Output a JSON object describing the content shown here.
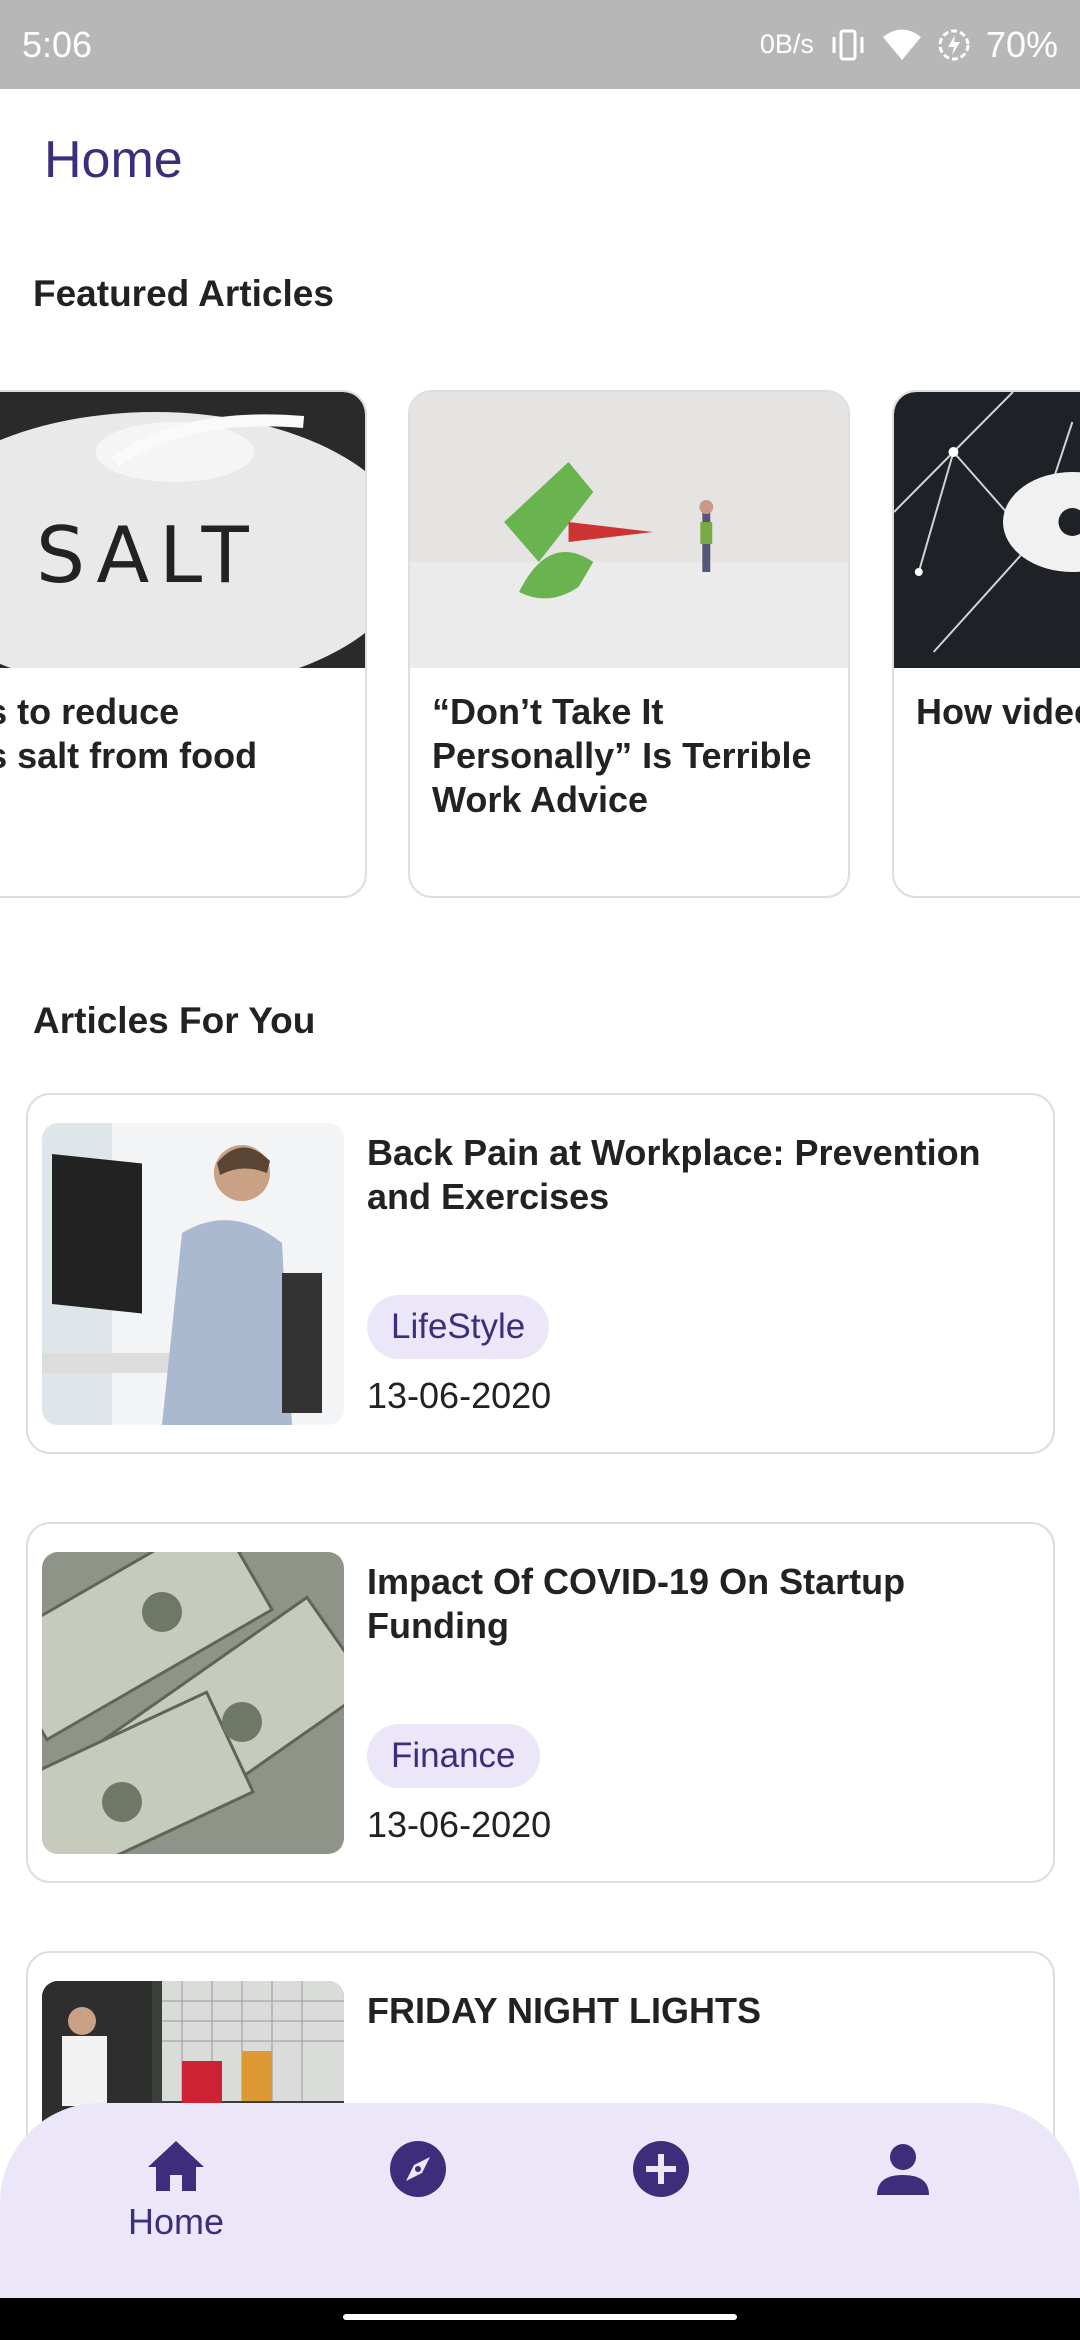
{
  "status_bar": {
    "time": "5:06",
    "speed": "0B/s",
    "battery": "70%"
  },
  "page": {
    "title": "Home"
  },
  "featured": {
    "title": "Featured Articles",
    "items": [
      {
        "title": "acks to reduce\ncess salt from food",
        "image": "salt-photo"
      },
      {
        "title": "“Don’t Take It Personally” Is Terrible Work Advice",
        "image": "stapler-photo"
      },
      {
        "title": "How videc\naffect the",
        "image": "gamepad-network-photo"
      }
    ]
  },
  "for_you": {
    "title": "Articles For You",
    "items": [
      {
        "title": "Back Pain at Workplace: Prevention and Exercises",
        "category": "LifeStyle",
        "date": "13-06-2020",
        "image": "office-worker-photo"
      },
      {
        "title": "Impact Of COVID-19 On Startup Funding",
        "category": "Finance",
        "date": "13-06-2020",
        "image": "dollar-bills-photo"
      },
      {
        "title": "FRIDAY NIGHT LIGHTS",
        "category": "",
        "date": "",
        "image": "football-photo"
      }
    ]
  },
  "bottom_nav": {
    "items": [
      {
        "label": "Home",
        "icon": "home-icon",
        "active": true
      },
      {
        "label": "",
        "icon": "compass-icon",
        "active": false
      },
      {
        "label": "",
        "icon": "add-circle-icon",
        "active": false
      },
      {
        "label": "",
        "icon": "person-icon",
        "active": false
      }
    ]
  },
  "colors": {
    "accent": "#3c2e7a",
    "chip_bg": "#ebe7f8",
    "status_bar": "#b7b7b7"
  }
}
